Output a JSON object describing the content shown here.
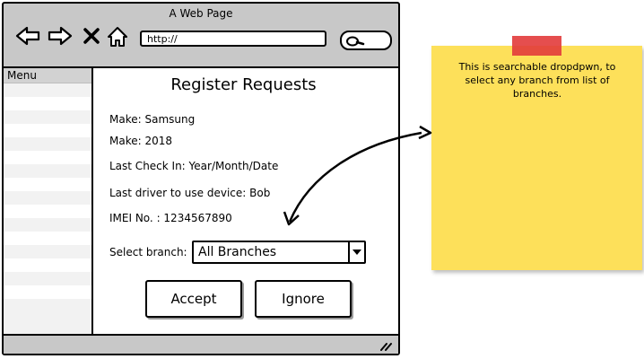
{
  "window": {
    "title": "A Web Page"
  },
  "nav": {
    "back_icon": "back-arrow-icon",
    "forward_icon": "forward-arrow-icon",
    "close_icon": "close-icon",
    "home_icon": "home-icon",
    "url": "http://",
    "search_icon": "search-icon"
  },
  "sidebar": {
    "header": "Menu",
    "stripes": 16
  },
  "form": {
    "heading": "Register Requests",
    "fields": [
      {
        "text": "Make: Samsung"
      },
      {
        "text": "Make: 2018"
      },
      {
        "text": "Last Check In: Year/Month/Date"
      },
      {
        "text": "Last driver to use device: Bob"
      },
      {
        "text": "IMEI No. : 1234567890"
      }
    ],
    "select_label": "Select branch:",
    "select_value": "All Branches",
    "accept_label": "Accept",
    "ignore_label": "Ignore"
  },
  "note": {
    "text": "This is searchable dropdpwn, to select any branch from list of branches.",
    "color": "#fde05a",
    "tape_color": "#e23b3b"
  }
}
